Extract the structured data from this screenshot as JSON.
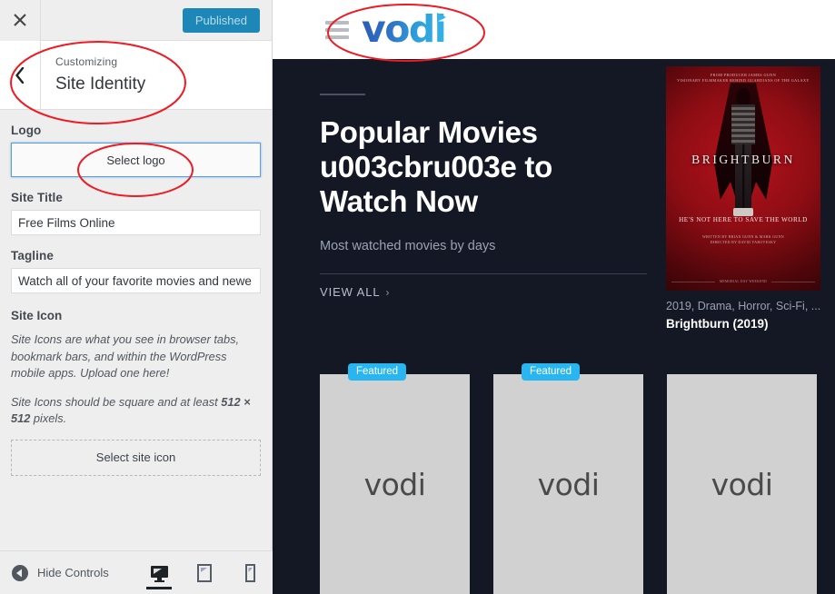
{
  "customizer": {
    "close_icon": "close-x-icon",
    "publish_button": "Published",
    "back_icon": "chevron-left-icon",
    "subtitle": "Customizing",
    "title": "Site Identity",
    "fields": {
      "logo_label": "Logo",
      "logo_button": "Select logo",
      "site_title_label": "Site Title",
      "site_title_value": "Free Films Online",
      "tagline_label": "Tagline",
      "tagline_value": "Watch all of your favorite movies and newe",
      "site_icon_label": "Site Icon",
      "site_icon_help_1": "Site Icons are what you see in browser tabs, bookmark bars, and within the WordPress mobile apps. Upload one here!",
      "site_icon_help_2_pre": "Site Icons should be square and at least ",
      "site_icon_help_2_size": "512 × 512",
      "site_icon_help_2_post": " pixels.",
      "site_icon_button": "Select site icon"
    },
    "footer": {
      "hide_controls": "Hide Controls",
      "collapse_icon": "collapse-arrow-icon",
      "devices": [
        {
          "name": "desktop-preview",
          "icon": "desktop-icon",
          "active": true
        },
        {
          "name": "tablet-preview",
          "icon": "tablet-icon",
          "active": false
        },
        {
          "name": "mobile-preview",
          "icon": "mobile-icon",
          "active": false
        }
      ]
    }
  },
  "preview": {
    "header": {
      "menu_icon": "hamburger-menu-icon",
      "logo_text": "vodi"
    },
    "hero": {
      "title": "Popular Movies u003cbru003e to Watch Now",
      "subtitle": "Most watched movies by days",
      "view_all": "VIEW ALL",
      "view_all_chevron": "›"
    },
    "featured_movie": {
      "poster_top_line_1": "FROM PRODUCER JAMES GUNN",
      "poster_top_line_2": "VISIONARY FILMMAKER BEHIND GUARDIANS OF THE GALAXY",
      "poster_title": "BRIGHTBURN",
      "poster_tagline": "HE'S NOT HERE TO SAVE THE WORLD",
      "poster_credits_1": "WRITTEN BY BRIAN GUNN & MARK GUNN",
      "poster_credits_2": "DIRECTED BY DAVID YAROVESKY",
      "poster_release": "MEMORIAL DAY WEEKEND",
      "meta": "2019, Drama, Horror, Sci-Fi, ...",
      "name": "Brightburn (2019)"
    },
    "cards": [
      {
        "placeholder": "vodi",
        "badge": "Featured"
      },
      {
        "placeholder": "vodi",
        "badge": "Featured"
      },
      {
        "placeholder": "vodi",
        "badge": ""
      }
    ]
  },
  "colors": {
    "accent_blue": "#1d87b8",
    "badge_blue": "#29b6f0",
    "preview_bg": "#141824",
    "annotation_red": "#ee1b24",
    "logo_blue_dark": "#2b5bb5",
    "logo_blue_light": "#35b3e8"
  }
}
